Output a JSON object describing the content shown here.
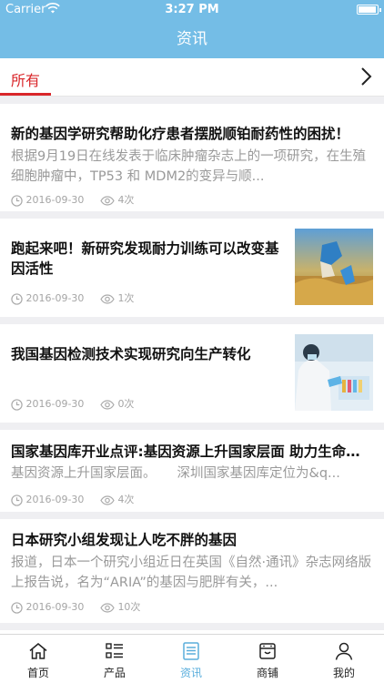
{
  "status": {
    "carrier": "Carrier",
    "time": "3:27 PM"
  },
  "nav": {
    "title": "资讯"
  },
  "tabs": {
    "active": "所有"
  },
  "articles": [
    {
      "title": "新的基因学研究帮助化疗患者摆脱顺铂耐药性的困扰！",
      "summary": "根据9月19日在线发表于临床肿瘤杂志上的一项研究，在生殖细胞肿瘤中，TP53 和 MDM2的变异与顺...",
      "date": "2016-09-30",
      "views": "4次"
    },
    {
      "title": "跑起来吧！新研究发现耐力训练可以改变基因活性",
      "date": "2016-09-30",
      "views": "1次",
      "image": "running-shoes-photo"
    },
    {
      "title": "我国基因检测技术实现研究向生产转化",
      "date": "2016-09-30",
      "views": "0次",
      "image": "lab-scientist-photo"
    },
    {
      "title": "国家基因库开业点评:基因资源上升国家层面 助力生命科学...",
      "summary": "基因资源上升国家层面。     深圳国家基因库定位为&q...",
      "date": "2016-09-30",
      "views": "4次"
    },
    {
      "title": "日本研究小组发现让人吃不胖的基因",
      "summary": "报道，日本一个研究小组近日在英国《自然·通讯》杂志网络版上报告说，名为“ARIA”的基因与肥胖有关，...",
      "date": "2016-09-30",
      "views": "10次"
    }
  ],
  "tabbar": {
    "items": [
      {
        "label": "首页",
        "icon": "home-icon"
      },
      {
        "label": "产品",
        "icon": "list-icon"
      },
      {
        "label": "资讯",
        "icon": "document-icon"
      },
      {
        "label": "商铺",
        "icon": "shop-icon"
      },
      {
        "label": "我的",
        "icon": "person-icon"
      }
    ],
    "active_color": "#5aaedc"
  },
  "colors": {
    "nav": "#74bde6",
    "accent": "#d9262a"
  }
}
